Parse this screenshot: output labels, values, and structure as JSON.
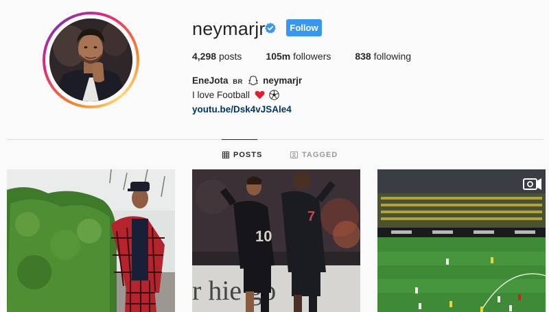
{
  "profile": {
    "username": "neymarjr",
    "follow_label": "Follow",
    "avatar_alt": "profile-photo"
  },
  "stats": {
    "posts_count": "4,298",
    "posts_label": "posts",
    "followers_count": "105m",
    "followers_label": "followers",
    "following_count": "838",
    "following_label": "following"
  },
  "bio": {
    "full_name": "EneJota",
    "country_tag": "BR",
    "mention": "neymarjr",
    "text": "I love Football",
    "link": "youtu.be/Dsk4vJSAle4"
  },
  "tabs": [
    {
      "label": "POSTS",
      "icon": "grid-icon",
      "active": true
    },
    {
      "label": "TAGGED",
      "icon": "tag-icon",
      "active": false
    }
  ],
  "posts": [
    {
      "name": "post-street-hedge",
      "video": false
    },
    {
      "name": "post-psg-celebration",
      "video": false
    },
    {
      "name": "post-football-stadium",
      "video": true
    }
  ],
  "colors": {
    "accent": "#3897f0",
    "link": "#003569",
    "verified": "#3897f0",
    "text": "#262626",
    "muted": "#999999",
    "divider": "#dbdbdb"
  }
}
